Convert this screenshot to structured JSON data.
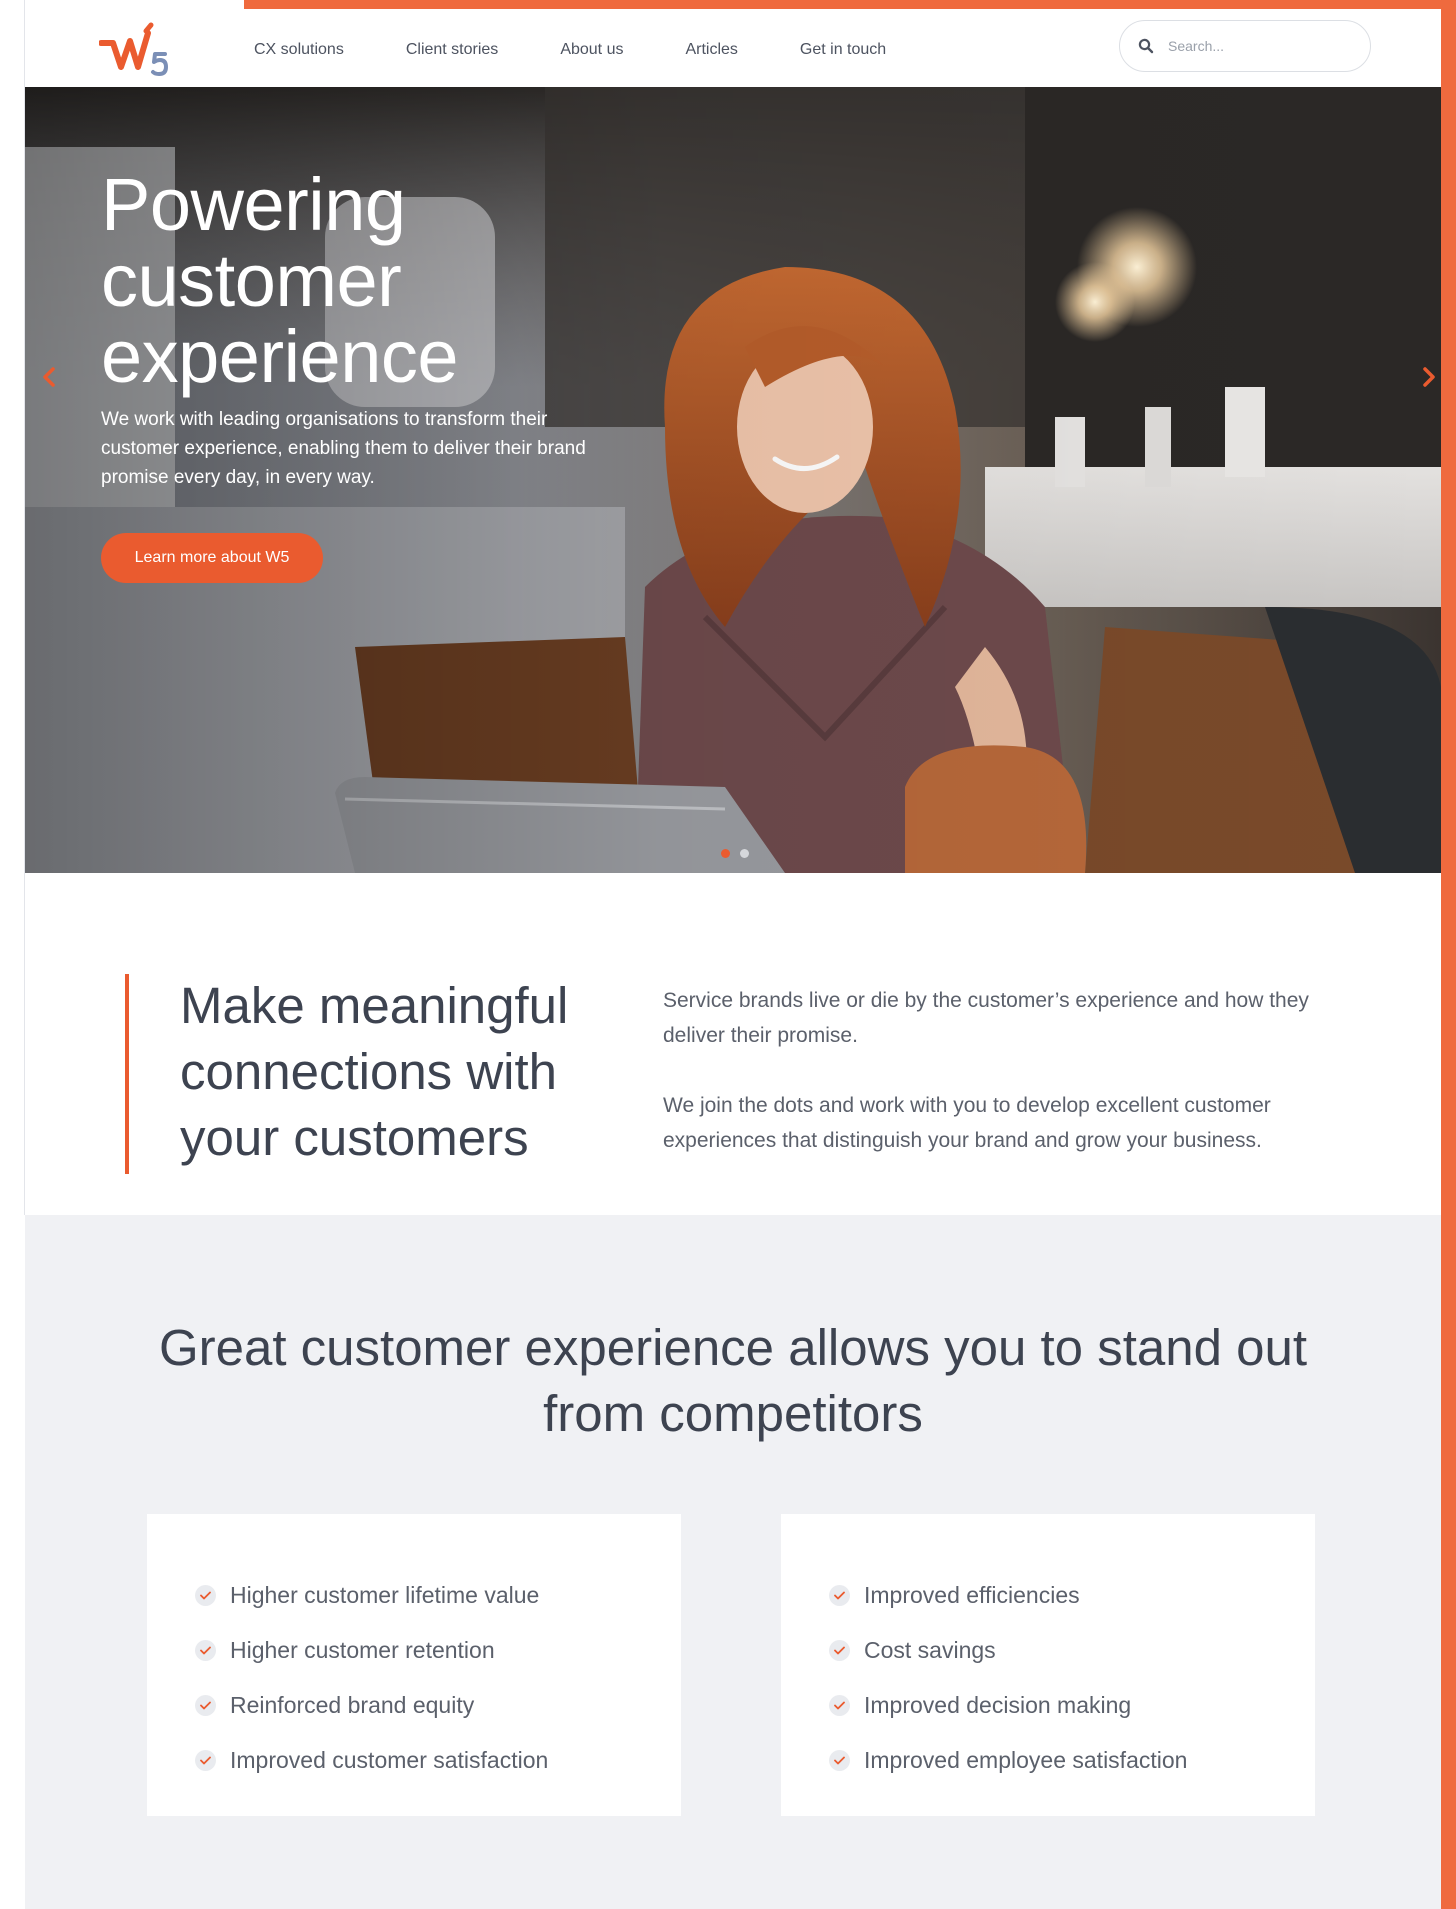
{
  "nav": {
    "items": [
      {
        "label": "CX solutions"
      },
      {
        "label": "Client stories"
      },
      {
        "label": "About us"
      },
      {
        "label": "Articles"
      },
      {
        "label": "Get in touch"
      }
    ],
    "search_placeholder": "Search..."
  },
  "hero": {
    "title": "Powering customer experience",
    "text": "We work with leading organisations to transform their customer experience, enabling them to deliver their brand promise every day, in every way.",
    "button_label": "Learn more about W5",
    "slides": 2,
    "active_slide": 1
  },
  "intro": {
    "title": "Make meaningful connections with your customers",
    "paragraph1": "Service brands live or die by the customer’s experience and how they deliver their promise.",
    "paragraph2": "We join the dots and work with you to develop excellent customer experiences that distinguish your brand and grow your business."
  },
  "benefits": {
    "title": "Great customer experience allows you to stand out from competitors",
    "left": [
      "Higher customer lifetime value",
      "Higher customer retention",
      "Reinforced brand equity",
      "Improved customer satisfaction"
    ],
    "right": [
      "Improved efficiencies",
      "Cost savings",
      "Improved decision making",
      "Improved employee satisfaction"
    ]
  },
  "colors": {
    "accent": "#ea5b2f",
    "frame": "#ef6a3e",
    "text_dark": "#3d4350",
    "section_bg": "#f0f1f4"
  },
  "icons": {
    "logo": "w5-logo",
    "search": "search-icon",
    "check": "check-icon",
    "prev": "chevron-left-icon",
    "next": "chevron-right-icon"
  }
}
